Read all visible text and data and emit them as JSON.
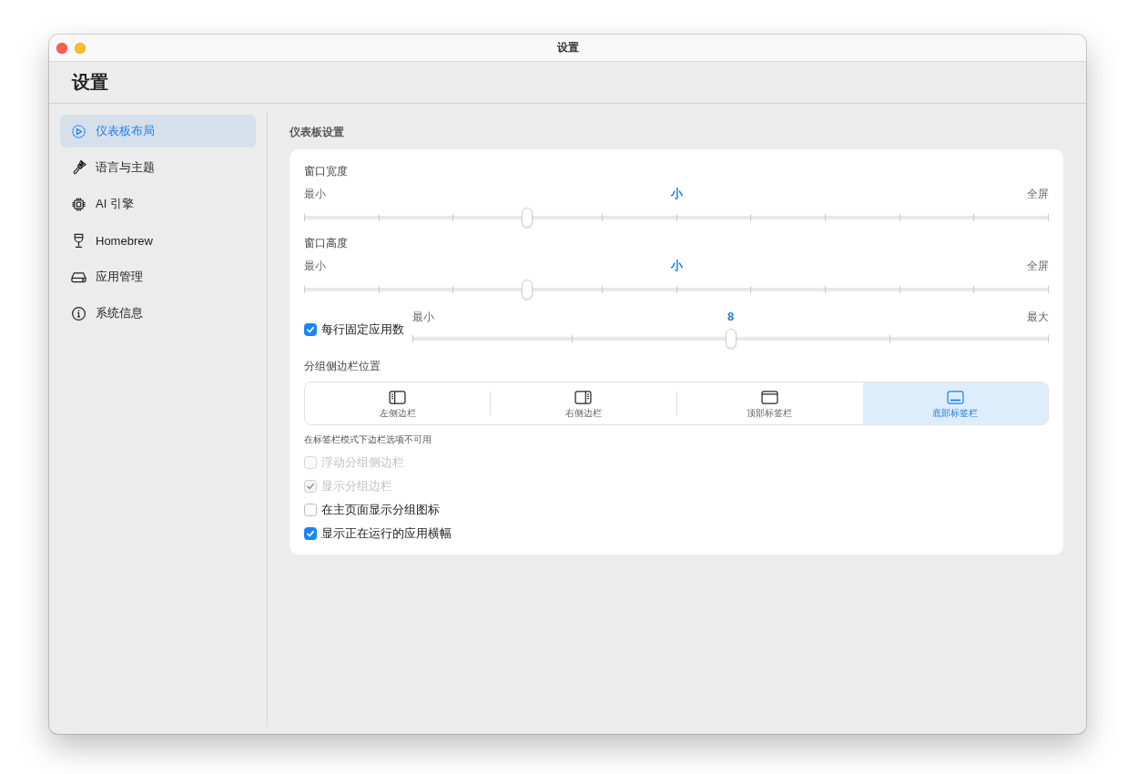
{
  "window": {
    "title": "设置"
  },
  "header": {
    "title": "设置"
  },
  "sidebar": {
    "items": [
      {
        "label": "仪表板布局",
        "selected": true
      },
      {
        "label": "语言与主题",
        "selected": false
      },
      {
        "label": "AI 引擎",
        "selected": false
      },
      {
        "label": "Homebrew",
        "selected": false
      },
      {
        "label": "应用管理",
        "selected": false
      },
      {
        "label": "系统信息",
        "selected": false
      }
    ]
  },
  "main": {
    "section_title": "仪表板设置",
    "sliders": [
      {
        "kind": "fine",
        "label": "窗口宽度",
        "min_label": "最小",
        "value": "小",
        "max_label": "全屏",
        "level": 0.3
      },
      {
        "kind": "fine",
        "label": "窗口高度",
        "min_label": "最小",
        "value": "小",
        "max_label": "全屏",
        "level": 0.3
      }
    ],
    "pinned_apps": {
      "kind": "coarse",
      "label": "每行固定应用数",
      "checked": true,
      "min_label": "最小",
      "value": "8",
      "max_label": "最大",
      "level": 0.5
    },
    "sidebar_position": {
      "label": "分组侧边栏位置",
      "options": [
        {
          "label": "左侧边栏",
          "selected": false
        },
        {
          "label": "右侧边栏",
          "selected": false
        },
        {
          "label": "顶部标签栏",
          "selected": false
        },
        {
          "label": "底部标签栏",
          "selected": true
        }
      ],
      "note": "在标签栏模式下边栏选项不可用"
    },
    "options": [
      {
        "label": "浮动分组侧边栏",
        "checked": false,
        "disabled": true
      },
      {
        "label": "显示分组边栏",
        "checked": true,
        "disabled": true
      },
      {
        "label": "在主页面显示分组图标",
        "checked": false,
        "disabled": false
      },
      {
        "label": "显示正在运行的应用横幅",
        "checked": true,
        "disabled": false
      }
    ]
  }
}
